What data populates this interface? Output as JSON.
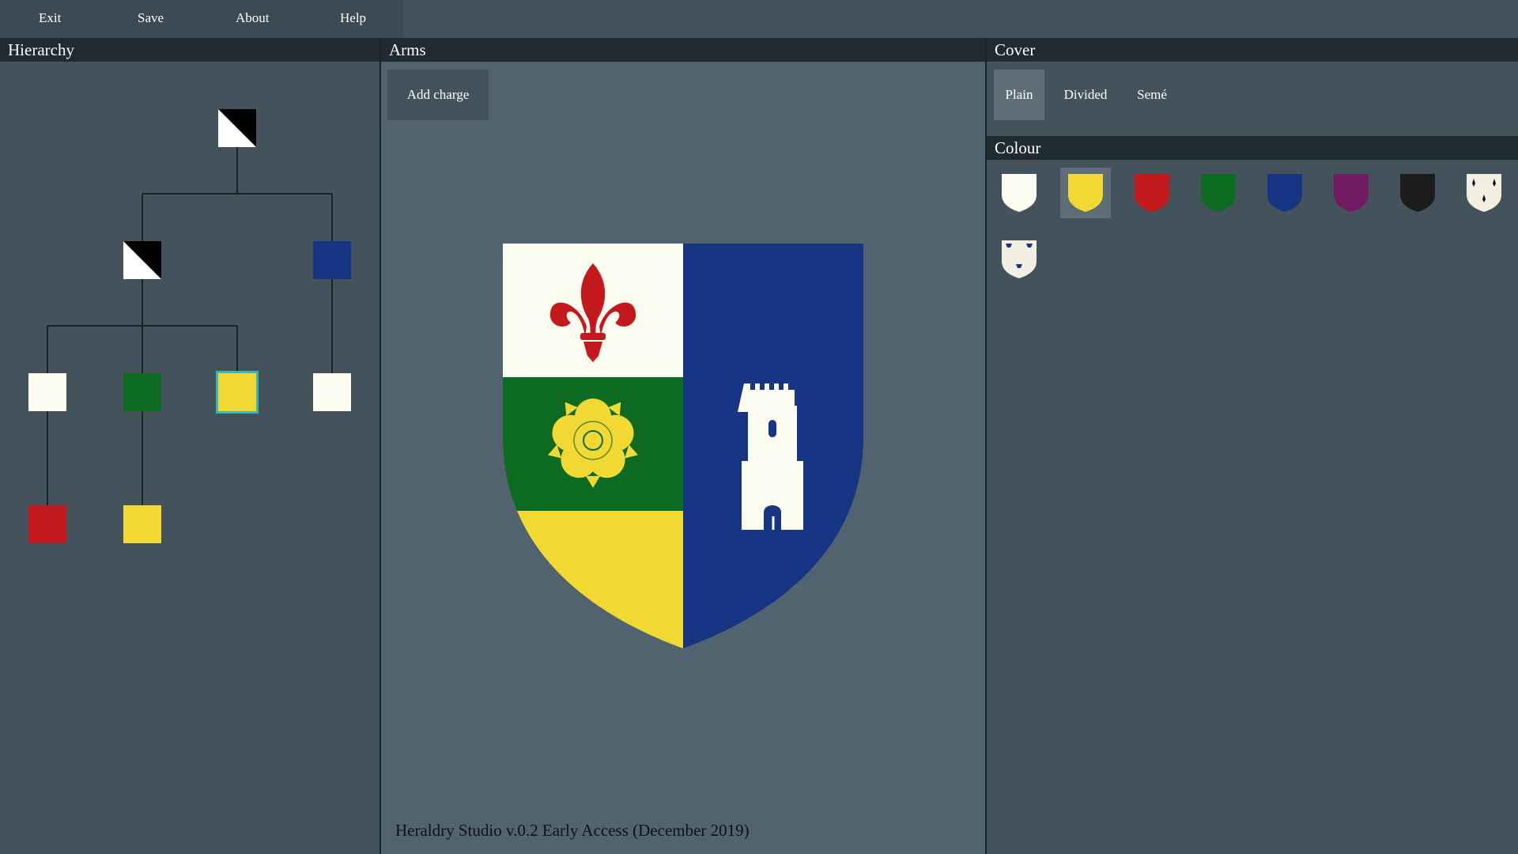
{
  "menu": {
    "exit": "Exit",
    "save": "Save",
    "about": "About",
    "help": "Help"
  },
  "panels": {
    "hierarchy": "Hierarchy",
    "arms": "Arms",
    "cover": "Cover",
    "colour": "Colour"
  },
  "arms": {
    "add_charge": "Add charge",
    "charges": [
      "fleur-de-lis-icon",
      "tudor-rose-icon",
      "tower-icon"
    ]
  },
  "cover": {
    "options": [
      "Plain",
      "Divided",
      "Semé"
    ],
    "selected": "Plain"
  },
  "colours": {
    "argent": "#fdfcf0",
    "or": "#f2d833",
    "gules": "#c4191c",
    "vert": "#0c6b21",
    "azure": "#163582",
    "purpure": "#721b63",
    "sable": "#1c1c1c",
    "ermine": "ermine-icon",
    "vair": "ermine-blue-icon",
    "selected": "or"
  },
  "hierarchy": {
    "selected_node": "node-or-quarter"
  },
  "footer": {
    "version": "Heraldry Studio v.0.2 Early Access (December 2019)"
  }
}
